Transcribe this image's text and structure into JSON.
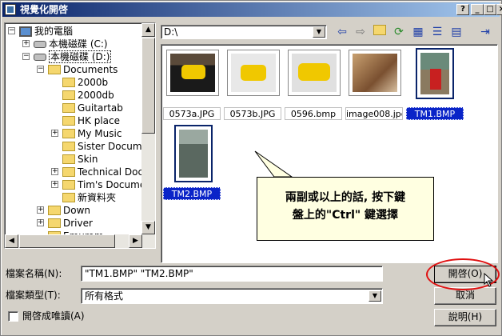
{
  "window": {
    "title": "視覺化開啓",
    "controls": [
      "?",
      "_",
      "□",
      "×"
    ]
  },
  "tree": {
    "items": [
      {
        "label": "我的電腦",
        "icon": "computer-icon",
        "expander": "−"
      },
      {
        "label": "本機磁碟 (C:)",
        "icon": "drive-icon",
        "expander": "+"
      },
      {
        "label": "本機磁碟 (D:)",
        "icon": "drive-icon",
        "expander": "−",
        "selected": true
      },
      {
        "label": "Documents",
        "icon": "folder-icon",
        "expander": "−"
      },
      {
        "label": "2000b",
        "icon": "folder-icon",
        "expander": ""
      },
      {
        "label": "2000db",
        "icon": "folder-icon",
        "expander": ""
      },
      {
        "label": "Guitartab",
        "icon": "folder-icon",
        "expander": ""
      },
      {
        "label": "HK place",
        "icon": "folder-icon",
        "expander": ""
      },
      {
        "label": "My Music",
        "icon": "folder-icon",
        "expander": "+"
      },
      {
        "label": "Sister Documer",
        "icon": "folder-icon",
        "expander": ""
      },
      {
        "label": "Skin",
        "icon": "folder-icon",
        "expander": ""
      },
      {
        "label": "Technical Doc",
        "icon": "folder-icon",
        "expander": "+"
      },
      {
        "label": "Tim's Documer",
        "icon": "folder-icon",
        "expander": "+"
      },
      {
        "label": "新資料夾",
        "icon": "folder-icon",
        "expander": ""
      },
      {
        "label": "Down",
        "icon": "folder-icon",
        "expander": "+"
      },
      {
        "label": "Driver",
        "icon": "folder-icon",
        "expander": "+"
      },
      {
        "label": "Emurom",
        "icon": "folder-icon",
        "expander": ""
      }
    ]
  },
  "path": {
    "value": "D:\\"
  },
  "toolbar": [
    "back-icon",
    "forward-icon",
    "up-folder-icon",
    "refresh-icon",
    "thumbnails-icon",
    "list-icon",
    "details-icon",
    "pin-icon"
  ],
  "files": [
    {
      "name": "0573a.JPG",
      "selected": false
    },
    {
      "name": "0573b.JPG",
      "selected": false
    },
    {
      "name": "0596.bmp",
      "selected": false
    },
    {
      "name": "image008.jpg",
      "selected": false
    },
    {
      "name": "TM1.BMP",
      "selected": true
    },
    {
      "name": "TM2.BMP",
      "selected": true
    }
  ],
  "callout": {
    "line1": "兩副或以上的話, 按下鍵",
    "line2": "盤上的\"Ctrl\" 鍵選擇"
  },
  "form": {
    "filename_label": "檔案名稱(N):",
    "filename_value": "\"TM1.BMP\" \"TM2.BMP\"",
    "filetype_label": "檔案類型(T):",
    "filetype_value": "所有格式",
    "readonly_label": "開啓成唯讀(A)",
    "readonly_checked": false
  },
  "buttons": {
    "open": "開啓(O)",
    "cancel": "取消",
    "help": "說明(H)"
  },
  "colors": {
    "titlebar": "#0a246a",
    "selection": "#0a24c8",
    "callout": "#ffffe1",
    "highlight_ring": "#e01010"
  }
}
